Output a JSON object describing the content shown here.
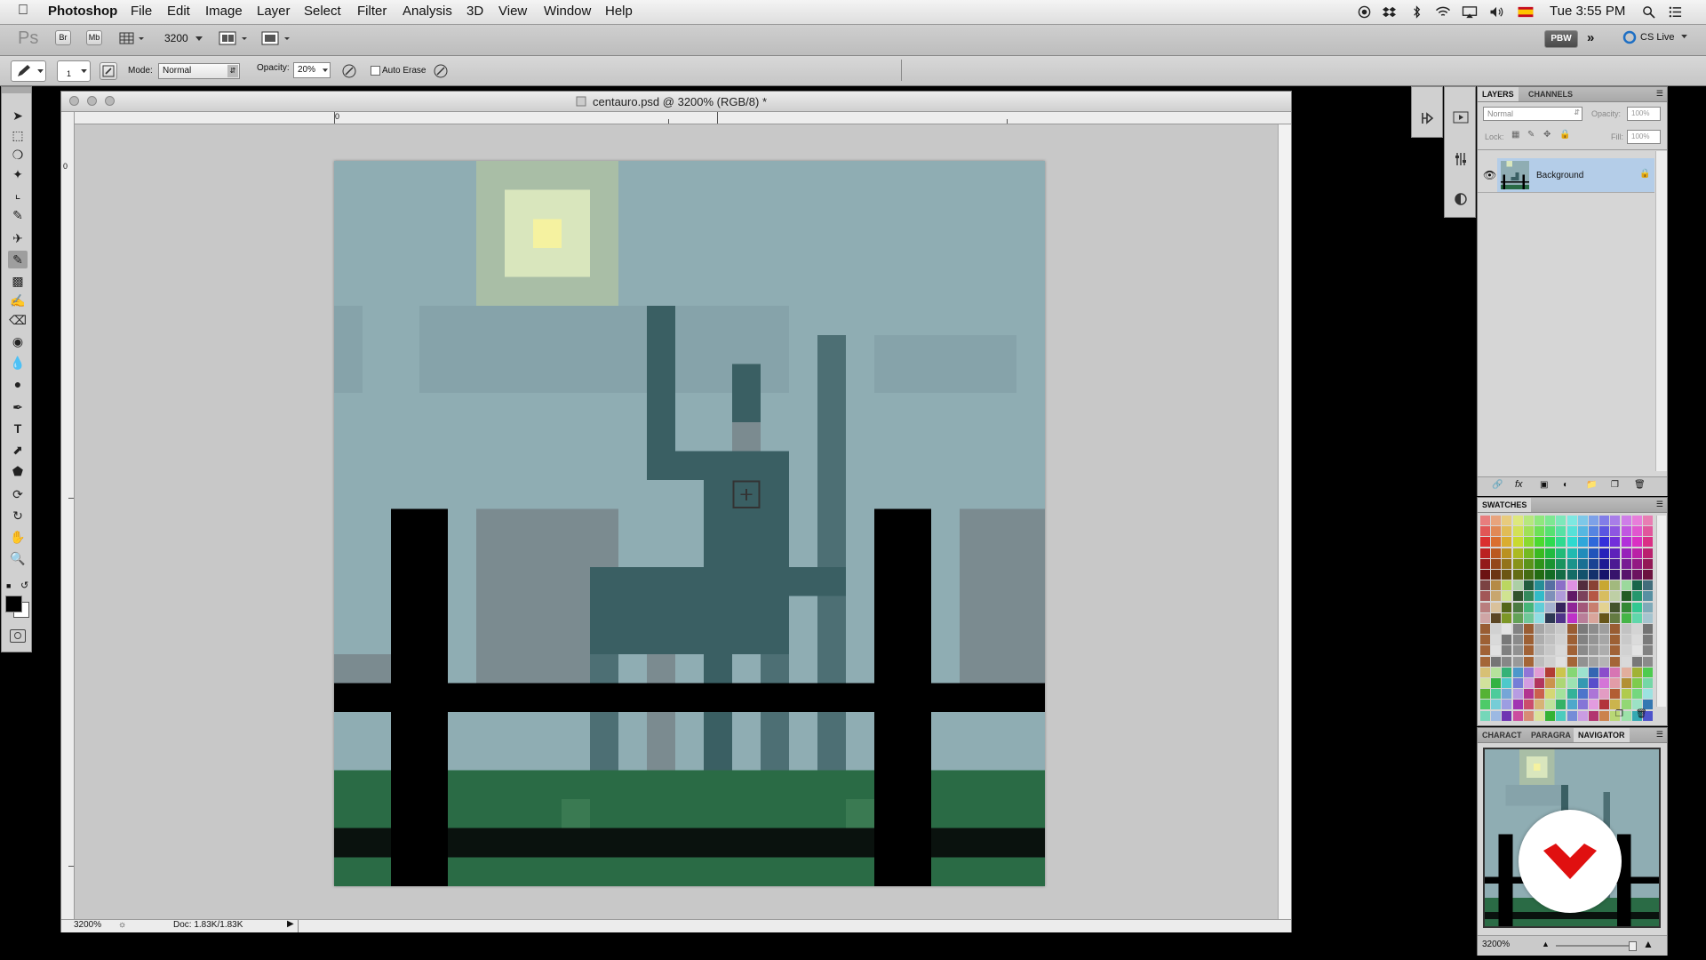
{
  "menubar": {
    "app_name": "Photoshop",
    "items": [
      "File",
      "Edit",
      "Image",
      "Layer",
      "Select",
      "Filter",
      "Analysis",
      "3D",
      "View",
      "Window",
      "Help"
    ],
    "clock": "Tue 3:55 PM"
  },
  "options_bar": {
    "zoom_value": "3200",
    "ps_label": "Ps",
    "br_label": "Br",
    "mb_label": "Mb",
    "workspace_label": "PBW",
    "cs_live_label": "CS Live"
  },
  "tool_options": {
    "brush_size": "1",
    "mode_label": "Mode:",
    "mode_value": "Normal",
    "opacity_label": "Opacity:",
    "opacity_value": "20%",
    "auto_erase_label": "Auto Erase",
    "auto_erase_checked": false
  },
  "document": {
    "title": "centauro.psd @ 3200% (RGB/8) *",
    "ruler_h_zero": "0",
    "ruler_v_zero": "0",
    "zoom_status": "3200%",
    "doc_size": "Doc: 1.83K/1.83K"
  },
  "layers_panel": {
    "tabs": [
      "LAYERS",
      "CHANNELS"
    ],
    "active_tab": "LAYERS",
    "blend_mode": "Normal",
    "opacity_label": "Opacity:",
    "opacity_value": "100%",
    "lock_label": "Lock:",
    "fill_label": "Fill:",
    "fill_value": "100%",
    "layers": [
      {
        "name": "Background",
        "visible": true,
        "locked": true
      }
    ]
  },
  "swatches_panel": {
    "tab": "SWATCHES"
  },
  "navigator_panel": {
    "tabs": [
      "CHARACT",
      "PARAGRA",
      "NAVIGATOR"
    ],
    "active_tab": "NAVIGATOR",
    "zoom_value": "3200%"
  },
  "colors": {
    "sky": "#8fadb3",
    "sky_dark": "#86a3aa",
    "moon_glow": "#a9bea6",
    "moon_mid": "#d9e6bd",
    "moon_core": "#f5f2a0",
    "centaur": "#3a5f63",
    "centaur_mid": "#4d6f74",
    "building": "#7b8b90",
    "grass": "#2a6b45",
    "grass_light": "#3a7a52",
    "fence": "#000000",
    "fence_lower": "#0a120e",
    "layer_selected": "#b4cde8"
  }
}
